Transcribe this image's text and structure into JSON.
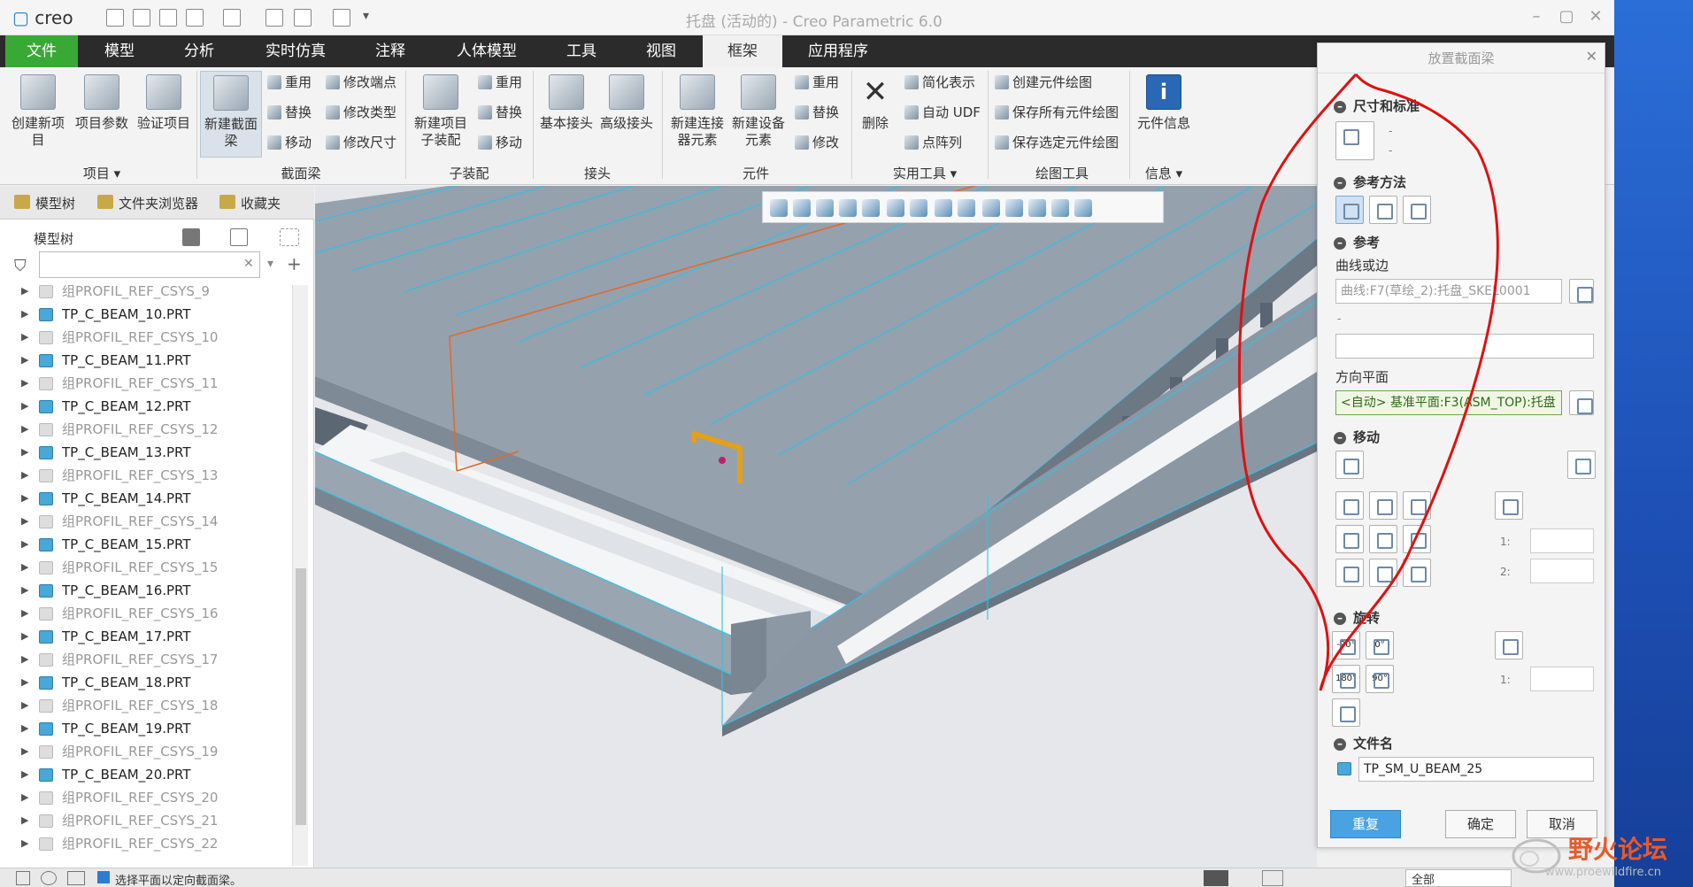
{
  "app": {
    "logo": "creo",
    "title": "托盘 (活动的) - Creo Parametric 6.0"
  },
  "tabs": [
    "文件",
    "模型",
    "分析",
    "实时仿真",
    "注释",
    "人体模型",
    "工具",
    "视图",
    "框架",
    "应用程序"
  ],
  "active_tab": "框架",
  "ribbon": {
    "groups": [
      {
        "label": "项目 ▾",
        "big_buttons": [
          "创建新项目",
          "项目参数",
          "验证项目"
        ]
      },
      {
        "label": "截面梁",
        "big_buttons": [
          "新建截面梁"
        ],
        "small_buttons": [
          "重用",
          "替换",
          "移动",
          "修改端点",
          "修改类型",
          "修改尺寸"
        ]
      },
      {
        "label": "子装配",
        "big_buttons": [
          "新建项目子装配"
        ],
        "small_buttons": [
          "重用",
          "替换",
          "移动"
        ]
      },
      {
        "label": "接头",
        "big_buttons": [
          "基本接头",
          "高级接头"
        ]
      },
      {
        "label": "元件",
        "big_buttons": [
          "新建连接器元素",
          "新建设备元素"
        ],
        "small_buttons": [
          "重用",
          "替换",
          "修改"
        ]
      },
      {
        "label": "实用工具 ▾",
        "big_buttons": [
          "删除"
        ],
        "small_buttons": [
          "简化表示",
          "自动 UDF",
          "点阵列"
        ]
      },
      {
        "label": "绘图工具",
        "small_buttons": [
          "创建元件绘图",
          "保存所有元件绘图",
          "保存选定元件绘图"
        ]
      },
      {
        "label": "信息 ▾",
        "big_buttons": [
          "元件信息"
        ]
      }
    ]
  },
  "left_panel": {
    "tabs": [
      "模型树",
      "文件夹浏览器",
      "收藏夹"
    ],
    "header": "模型树",
    "search_placeholder": "",
    "tree_items": [
      {
        "label": "组PROFIL_REF_CSYS_9",
        "kind": "group"
      },
      {
        "label": "TP_C_BEAM_10.PRT",
        "kind": "part"
      },
      {
        "label": "组PROFIL_REF_CSYS_10",
        "kind": "group"
      },
      {
        "label": "TP_C_BEAM_11.PRT",
        "kind": "part"
      },
      {
        "label": "组PROFIL_REF_CSYS_11",
        "kind": "group"
      },
      {
        "label": "TP_C_BEAM_12.PRT",
        "kind": "part"
      },
      {
        "label": "组PROFIL_REF_CSYS_12",
        "kind": "group"
      },
      {
        "label": "TP_C_BEAM_13.PRT",
        "kind": "part"
      },
      {
        "label": "组PROFIL_REF_CSYS_13",
        "kind": "group"
      },
      {
        "label": "TP_C_BEAM_14.PRT",
        "kind": "part"
      },
      {
        "label": "组PROFIL_REF_CSYS_14",
        "kind": "group"
      },
      {
        "label": "TP_C_BEAM_15.PRT",
        "kind": "part"
      },
      {
        "label": "组PROFIL_REF_CSYS_15",
        "kind": "group"
      },
      {
        "label": "TP_C_BEAM_16.PRT",
        "kind": "part"
      },
      {
        "label": "组PROFIL_REF_CSYS_16",
        "kind": "group"
      },
      {
        "label": "TP_C_BEAM_17.PRT",
        "kind": "part"
      },
      {
        "label": "组PROFIL_REF_CSYS_17",
        "kind": "group"
      },
      {
        "label": "TP_C_BEAM_18.PRT",
        "kind": "part"
      },
      {
        "label": "组PROFIL_REF_CSYS_18",
        "kind": "group"
      },
      {
        "label": "TP_C_BEAM_19.PRT",
        "kind": "part"
      },
      {
        "label": "组PROFIL_REF_CSYS_19",
        "kind": "group"
      },
      {
        "label": "TP_C_BEAM_20.PRT",
        "kind": "part"
      },
      {
        "label": "组PROFIL_REF_CSYS_20",
        "kind": "group"
      },
      {
        "label": "组PROFIL_REF_CSYS_21",
        "kind": "group"
      },
      {
        "label": "组PROFIL_REF_CSYS_22",
        "kind": "group"
      }
    ]
  },
  "dialog": {
    "title": "放置截面梁",
    "sections": {
      "size": "尺寸和标准",
      "ref_method": "参考方法",
      "reference": "参考",
      "move": "移动",
      "rotate": "旋转",
      "filename": "文件名"
    },
    "size_dashes": [
      "-",
      "-"
    ],
    "curve_label": "曲线或边",
    "curve_value": "曲线:F7(草绘_2):托盘_SKEL0001",
    "dash_label": "-",
    "second_ref_value": "",
    "direction_label": "方向平面",
    "direction_value": "<自动> 基准平面:F3(ASM_TOP):托盘",
    "move_spin_labels": [
      "1:",
      "2:"
    ],
    "rotate_buttons": [
      "-90°",
      "0°",
      "180°",
      "90°"
    ],
    "rotate_spin_label": "1:",
    "filename_value": "TP_SM_U_BEAM_25",
    "buttons": {
      "repeat": "重复",
      "ok": "确定",
      "cancel": "取消"
    }
  },
  "statusbar": {
    "message": "选择平面以定向截面梁。",
    "filter": "全部"
  },
  "watermark": {
    "title": "野火论坛",
    "url": "www.proewildfire.cn"
  },
  "colors": {
    "file_tab": "#39a935",
    "tab_bar": "#2b2b2b",
    "annotation_red": "#e01010",
    "plank_gray": "#8f9aa8",
    "edge_cyan": "#2cc3e8",
    "sketch_orange": "#e06a2c",
    "beam_yellow": "#e3a018",
    "primary_button": "#4aa3e0"
  }
}
